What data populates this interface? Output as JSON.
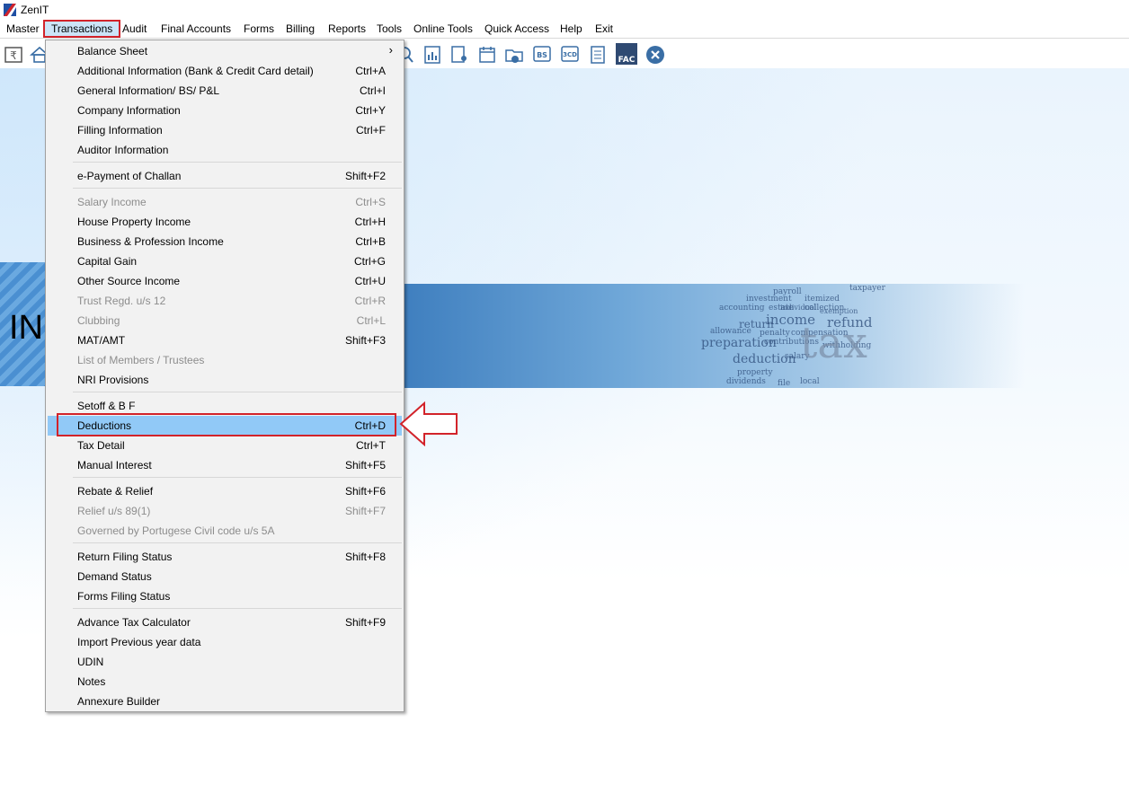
{
  "app": {
    "title": "ZenIT"
  },
  "menubar": {
    "items": [
      {
        "label": "Master"
      },
      {
        "label": "Transactions"
      },
      {
        "label": "Audit"
      },
      {
        "label": "Final Accounts"
      },
      {
        "label": "Forms"
      },
      {
        "label": "Billing"
      },
      {
        "label": "Reports"
      },
      {
        "label": "Tools"
      },
      {
        "label": "Online Tools"
      },
      {
        "label": "Quick Access"
      },
      {
        "label": "Help"
      },
      {
        "label": "Exit"
      }
    ]
  },
  "toolbar": {
    "icons": [
      "rupee-book-icon",
      "home-icon",
      "search-icon",
      "report-icon",
      "user-doc-icon",
      "calendar-icon",
      "folder-add-icon",
      "bs-icon",
      "3cd-icon",
      "document-list-icon",
      "fac-icon",
      "close-circle-icon"
    ],
    "labels": {
      "bs": "BS",
      "cd": "3CD",
      "fac": "FAC"
    }
  },
  "banner": {
    "left_text": "INC",
    "big_word": "tax",
    "words": [
      "payroll",
      "taxpayer",
      "investment",
      "itemized",
      "accounting",
      "estate",
      "collection",
      "refund",
      "income",
      "individual",
      "exemption",
      "preparation",
      "penalty",
      "compensation",
      "deduction",
      "contributions",
      "property",
      "salary",
      "withholding",
      "dividends",
      "file",
      "local",
      "allowance",
      "return"
    ]
  },
  "dropdown": {
    "items": [
      {
        "label": "Balance Sheet",
        "shortcut": "",
        "submenu": true,
        "disabled": false
      },
      {
        "label": "Additional Information (Bank & Credit Card detail)",
        "shortcut": "Ctrl+A",
        "disabled": false
      },
      {
        "label": "General Information/ BS/ P&L",
        "shortcut": "Ctrl+I",
        "disabled": false
      },
      {
        "label": "Company Information",
        "shortcut": "Ctrl+Y",
        "disabled": false
      },
      {
        "label": "Filling Information",
        "shortcut": "Ctrl+F",
        "disabled": false
      },
      {
        "label": "Auditor Information",
        "shortcut": "",
        "disabled": false
      },
      {
        "label": "e-Payment of Challan",
        "shortcut": "Shift+F2",
        "disabled": false
      },
      {
        "label": "Salary Income",
        "shortcut": "Ctrl+S",
        "disabled": true
      },
      {
        "label": "House Property Income",
        "shortcut": "Ctrl+H",
        "disabled": false
      },
      {
        "label": "Business & Profession Income",
        "shortcut": "Ctrl+B",
        "disabled": false
      },
      {
        "label": "Capital Gain",
        "shortcut": "Ctrl+G",
        "disabled": false
      },
      {
        "label": "Other Source Income",
        "shortcut": "Ctrl+U",
        "disabled": false
      },
      {
        "label": "Trust Regd. u/s 12",
        "shortcut": "Ctrl+R",
        "disabled": true
      },
      {
        "label": "Clubbing",
        "shortcut": "Ctrl+L",
        "disabled": true
      },
      {
        "label": "MAT/AMT",
        "shortcut": "Shift+F3",
        "disabled": false
      },
      {
        "label": "List of Members / Trustees",
        "shortcut": "",
        "disabled": true
      },
      {
        "label": "NRI Provisions",
        "shortcut": "",
        "disabled": false
      },
      {
        "label": "Setoff & B F",
        "shortcut": "",
        "disabled": false
      },
      {
        "label": "Deductions",
        "shortcut": "Ctrl+D",
        "disabled": false,
        "selected": true
      },
      {
        "label": "Tax Detail",
        "shortcut": "Ctrl+T",
        "disabled": false
      },
      {
        "label": "Manual Interest",
        "shortcut": "Shift+F5",
        "disabled": false
      },
      {
        "label": "Rebate & Relief",
        "shortcut": "Shift+F6",
        "disabled": false
      },
      {
        "label": "Relief u/s 89(1)",
        "shortcut": "Shift+F7",
        "disabled": true
      },
      {
        "label": "Governed by Portugese Civil code u/s 5A",
        "shortcut": "",
        "disabled": true
      },
      {
        "label": "Return Filing Status",
        "shortcut": "Shift+F8",
        "disabled": false
      },
      {
        "label": "Demand Status",
        "shortcut": "",
        "disabled": false
      },
      {
        "label": "Forms Filing Status",
        "shortcut": "",
        "disabled": false
      },
      {
        "label": "Advance Tax Calculator",
        "shortcut": "Shift+F9",
        "disabled": false
      },
      {
        "label": "Import Previous year data",
        "shortcut": "",
        "disabled": false
      },
      {
        "label": "UDIN",
        "shortcut": "",
        "disabled": false
      },
      {
        "label": "Notes",
        "shortcut": "",
        "disabled": false
      },
      {
        "label": "Annexure Builder",
        "shortcut": "",
        "disabled": false
      }
    ]
  },
  "colors": {
    "highlight_red": "#d2232a",
    "selected_row": "#91c9f7",
    "menu_active": "#cce4f7",
    "disabled_text": "#8d8d8d"
  }
}
